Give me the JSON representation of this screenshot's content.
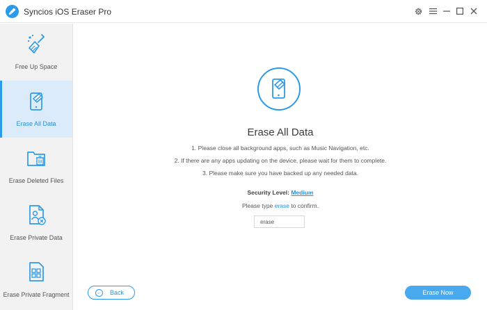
{
  "app": {
    "title": "Syncios iOS Eraser Pro",
    "accent_color": "#2c9ae8",
    "logo_icon": "broom-logo-icon"
  },
  "window_controls": [
    "gear-icon",
    "menu-icon",
    "minimize-icon",
    "maximize-icon",
    "close-icon"
  ],
  "sidebar": {
    "items": [
      {
        "label": "Free Up Space",
        "icon": "broom-icon",
        "active": false
      },
      {
        "label": "Erase All Data",
        "icon": "phone-eraser-icon",
        "active": true
      },
      {
        "label": "Erase Deleted Files",
        "icon": "folder-trash-icon",
        "active": false
      },
      {
        "label": "Erase Private Data",
        "icon": "private-file-icon",
        "active": false
      },
      {
        "label": "Erase Private Fragment",
        "icon": "fragment-icon",
        "active": false
      }
    ]
  },
  "main": {
    "hero_icon": "phone-eraser-icon",
    "title": "Erase All Data",
    "steps": [
      "1. Please close all background apps, such as Music Navigation, etc.",
      "2. If there are any apps updating on the device, please wait for them to complete.",
      "3. Please make sure you have backed up any needed data."
    ],
    "security_label": "Security Level:",
    "security_value": "Medium",
    "confirm_prefix": "Please type",
    "confirm_word": "erase",
    "confirm_suffix": "to confirm.",
    "confirm_input_value": "erase",
    "back_label": "Back",
    "erase_label": "Erase Now"
  }
}
